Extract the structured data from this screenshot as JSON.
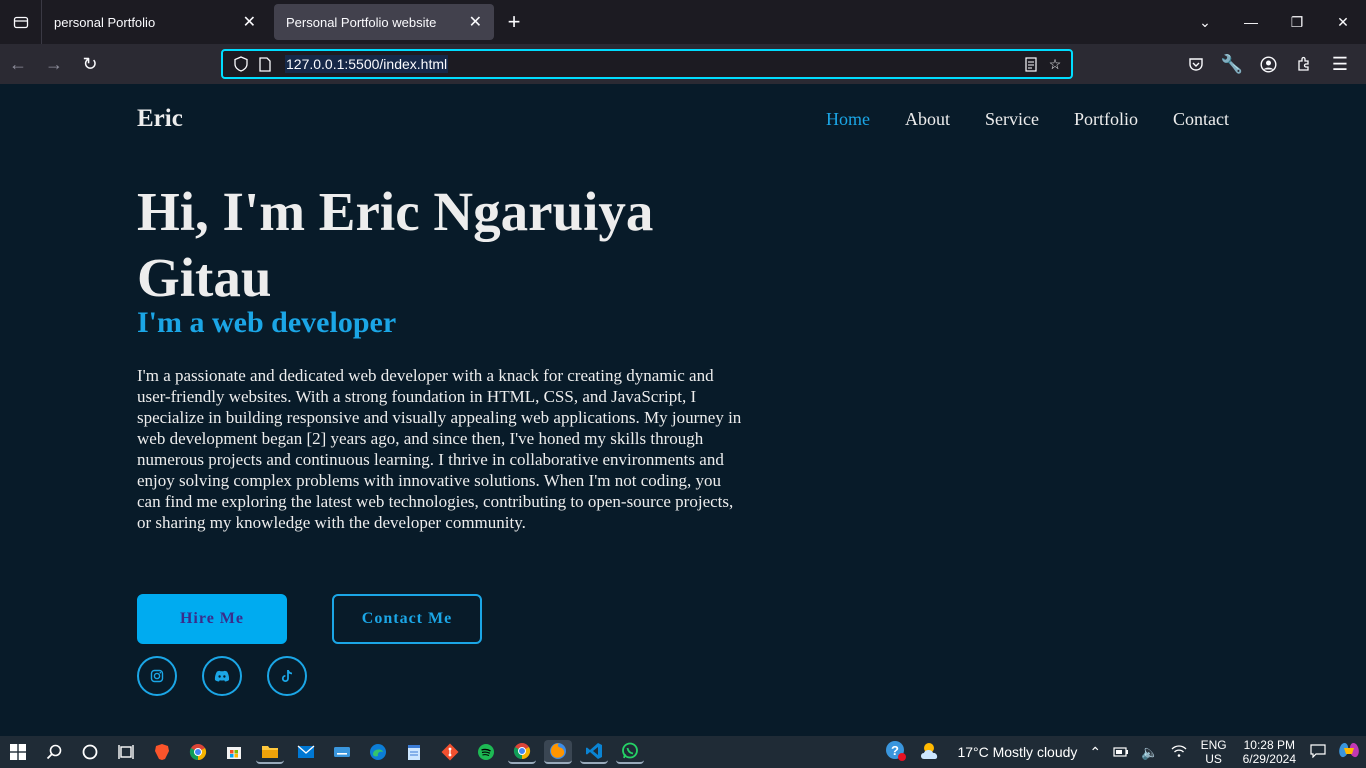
{
  "browser": {
    "tabs": [
      {
        "title": "personal Portfolio",
        "active": false
      },
      {
        "title": "Personal Portfolio website",
        "active": true
      }
    ],
    "url": "127.0.0.1:5500/index.html"
  },
  "site": {
    "logo": "Eric",
    "nav": [
      {
        "label": "Home",
        "active": true
      },
      {
        "label": "About",
        "active": false
      },
      {
        "label": "Service",
        "active": false
      },
      {
        "label": "Portfolio",
        "active": false
      },
      {
        "label": "Contact",
        "active": false
      }
    ],
    "hero": {
      "title": "Hi, I'm Eric Ngaruiya Gitau",
      "subtitle": "I'm a web developer",
      "text": "I'm a passionate and dedicated web developer with a knack for creating dynamic and user-friendly websites. With a strong foundation in HTML, CSS, and JavaScript, I specialize in building responsive and visually appealing web applications. My journey in web development began [2] years ago, and since then, I've honed my skills through numerous projects and continuous learning. I thrive in collaborative environments and enjoy solving complex problems with innovative solutions. When I'm not coding, you can find me exploring the latest web technologies, contributing to open-source projects, or sharing my knowledge with the developer community.",
      "hire_label": "Hire Me",
      "contact_label": "Contact Me"
    },
    "socials": [
      "instagram-icon",
      "discord-icon",
      "tiktok-icon"
    ],
    "colors": {
      "accent": "#1ba6e6",
      "background": "#081b29",
      "button": "#00abf0"
    }
  },
  "taskbar": {
    "weather": "17°C  Mostly cloudy",
    "lang_top": "ENG",
    "lang_bottom": "US",
    "time": "10:28 PM",
    "date": "6/29/2024"
  }
}
